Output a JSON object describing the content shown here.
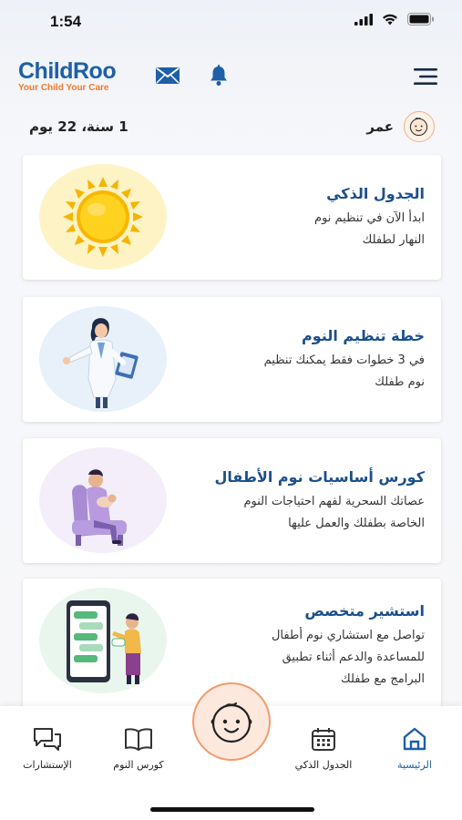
{
  "status": {
    "time": "1:54"
  },
  "header": {
    "brand": "ChildRoo",
    "tagline": "Your Child Your Care",
    "icons": [
      "mail-icon",
      "bell-icon",
      "menu-icon"
    ]
  },
  "age": {
    "label": "عمر",
    "value": "1 سنة، 22 يوم"
  },
  "cards": [
    {
      "title": "الجدول الذكي",
      "desc_line1": "ابدأ الآن في تنظيم نوم",
      "desc_line2": "النهار لطفلك",
      "desc_line3": ""
    },
    {
      "title": "خطة تنظيم النوم",
      "desc_line1": "في 3 خطوات فقط يمكنك تنظيم",
      "desc_line2": "نوم طفلك",
      "desc_line3": ""
    },
    {
      "title": "كورس أساسيات نوم الأطفال",
      "desc_line1": "عصاتك السحرية لفهم احتياجات النوم",
      "desc_line2": "الخاصة بطفلك والعمل عليها",
      "desc_line3": ""
    },
    {
      "title": "استشير متخصص",
      "desc_line1": "تواصل مع استشاري نوم أطفال",
      "desc_line2": "للمساعدة والدعم أثناء تطبيق",
      "desc_line3": "البرامج مع طفلك"
    }
  ],
  "nav": {
    "home": "الرئيسية",
    "schedule": "الجدول الذكي",
    "course": "كورس النوم",
    "consult": "الإستشارات"
  },
  "colors": {
    "brand_blue": "#1e5fa8",
    "brand_orange": "#f07a2a",
    "title_blue": "#1c4f8c"
  }
}
